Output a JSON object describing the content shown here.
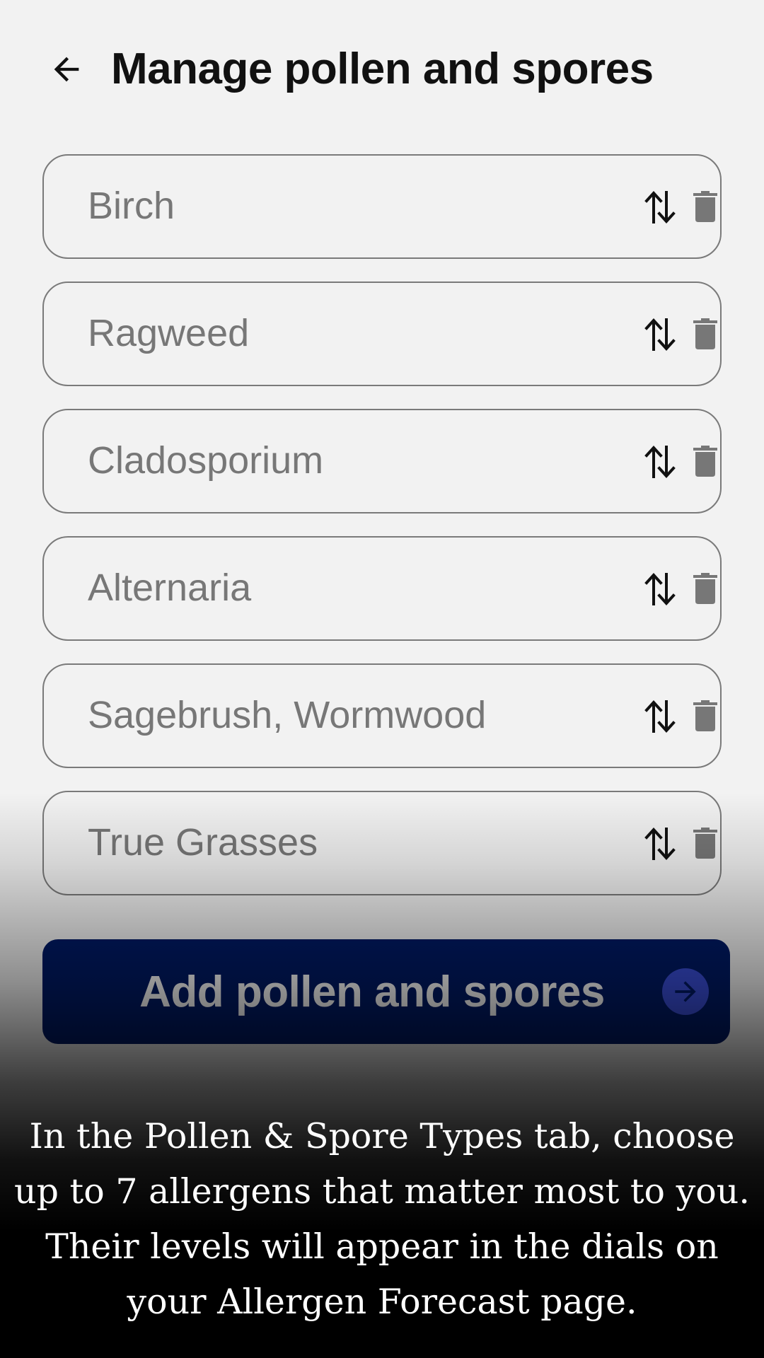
{
  "header": {
    "back_icon": "arrow-left-icon",
    "title": "Manage pollen and spores"
  },
  "allergens": [
    {
      "label": "Birch",
      "reorder_icon": "swap-vertical-icon",
      "delete_icon": "trash-icon"
    },
    {
      "label": "Ragweed",
      "reorder_icon": "swap-vertical-icon",
      "delete_icon": "trash-icon"
    },
    {
      "label": "Cladosporium",
      "reorder_icon": "swap-vertical-icon",
      "delete_icon": "trash-icon"
    },
    {
      "label": "Alternaria",
      "reorder_icon": "swap-vertical-icon",
      "delete_icon": "trash-icon"
    },
    {
      "label": "Sagebrush, Wormwood",
      "reorder_icon": "swap-vertical-icon",
      "delete_icon": "trash-icon"
    },
    {
      "label": "True Grasses",
      "reorder_icon": "swap-vertical-icon",
      "delete_icon": "trash-icon"
    }
  ],
  "add_button": {
    "label": "Add pollen and spores",
    "icon": "arrow-right-circle-icon",
    "color": "#001a66"
  },
  "tip_text": "In the Pollen & Spore Types tab, choose up to 7 allergens that matter most to you. Their levels will appear in the dials on your Allergen Forecast page.",
  "colors": {
    "background": "#f2f2f2",
    "item_text": "#777777",
    "item_border": "#7a7a7a",
    "icon_dark": "#111111",
    "icon_muted": "#777777",
    "accent_circle": "#3a4ed8"
  }
}
